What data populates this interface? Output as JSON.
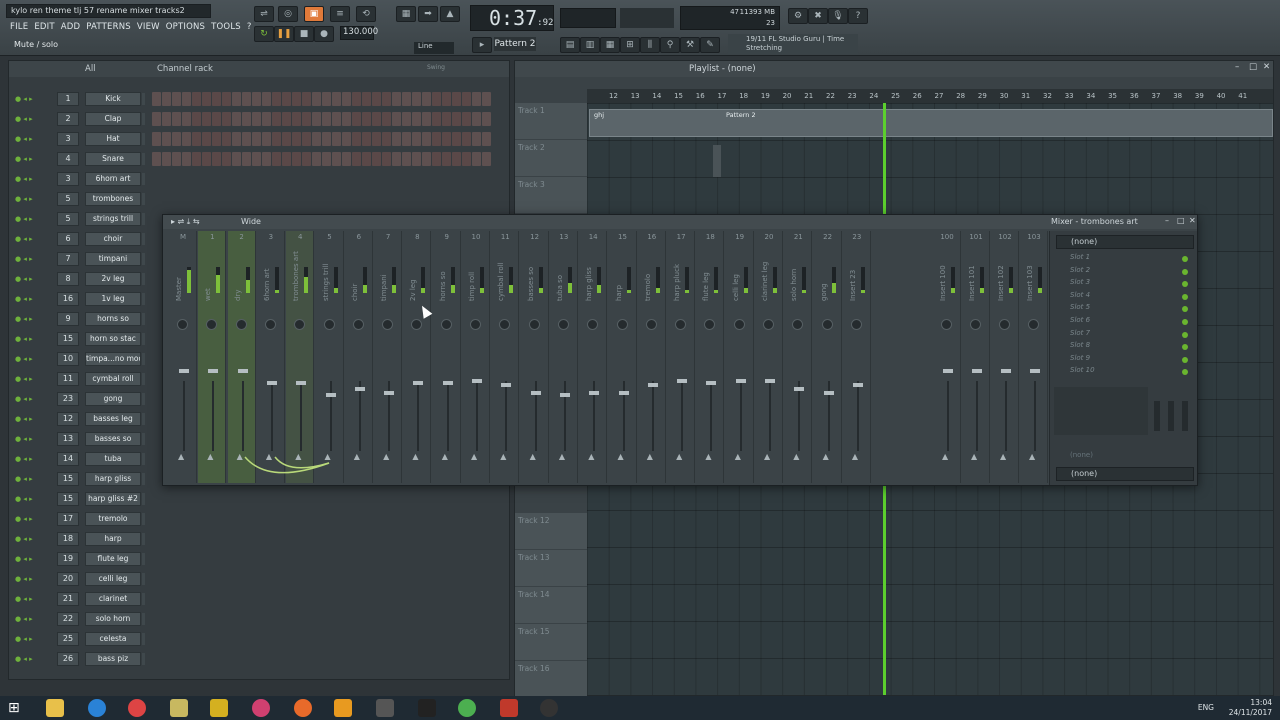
{
  "window": {
    "title": "kylo ren theme tlj 57 rename mixer tracks2"
  },
  "menu": [
    "FILE",
    "EDIT",
    "ADD",
    "PATTERNS",
    "VIEW",
    "OPTIONS",
    "TOOLS",
    "?"
  ],
  "hint": "Mute / solo",
  "transport": {
    "time": "0:37",
    "time_small": ":92",
    "tempo": "130.000",
    "pattern": "Pattern 2",
    "snap": "Line"
  },
  "cpu": {
    "a": "47",
    "b": "11393 MB",
    "c": "23"
  },
  "news": {
    "date": "19/11",
    "text": "FL Studio Guru | Time Stretching"
  },
  "rack": {
    "filter": "All",
    "title": "Channel rack",
    "swing_label": "Swing",
    "channels": [
      {
        "num": "1",
        "name": "Kick"
      },
      {
        "num": "2",
        "name": "Clap"
      },
      {
        "num": "3",
        "name": "Hat"
      },
      {
        "num": "4",
        "name": "Snare"
      },
      {
        "num": "3",
        "name": "6horn art"
      },
      {
        "num": "5",
        "name": "trombones"
      },
      {
        "num": "5",
        "name": "strings trill"
      },
      {
        "num": "6",
        "name": "choir"
      },
      {
        "num": "7",
        "name": "timpani"
      },
      {
        "num": "8",
        "name": "2v leg"
      },
      {
        "num": "16",
        "name": "1v leg"
      },
      {
        "num": "9",
        "name": "horns so"
      },
      {
        "num": "15",
        "name": "horn so stac"
      },
      {
        "num": "10",
        "name": "timpa...no mod"
      },
      {
        "num": "11",
        "name": "cymbal roll"
      },
      {
        "num": "23",
        "name": "gong"
      },
      {
        "num": "12",
        "name": "basses leg"
      },
      {
        "num": "13",
        "name": "basses so"
      },
      {
        "num": "14",
        "name": "tuba"
      },
      {
        "num": "15",
        "name": "harp gliss"
      },
      {
        "num": "15",
        "name": "harp gliss #2"
      },
      {
        "num": "17",
        "name": "tremolo"
      },
      {
        "num": "18",
        "name": "harp"
      },
      {
        "num": "19",
        "name": "flute leg"
      },
      {
        "num": "20",
        "name": "celli leg"
      },
      {
        "num": "21",
        "name": "clarinet"
      },
      {
        "num": "22",
        "name": "solo horn"
      },
      {
        "num": "25",
        "name": "celesta"
      },
      {
        "num": "26",
        "name": "bass piz"
      }
    ]
  },
  "playlist": {
    "title": "Playlist - (none)",
    "ruler": [
      "12",
      "13",
      "14",
      "15",
      "16",
      "17",
      "18",
      "19",
      "20",
      "21",
      "22",
      "23",
      "24",
      "25",
      "26",
      "27",
      "28",
      "29",
      "30",
      "31",
      "32",
      "33",
      "34",
      "35",
      "36",
      "37",
      "38",
      "39",
      "40",
      "41"
    ],
    "clip1": "ghj",
    "clip2": "Pattern 2",
    "tracks": [
      "Track 1",
      "Track 2",
      "Track 3",
      "Track 12",
      "Track 13",
      "Track 14",
      "Track 15",
      "Track 16"
    ]
  },
  "mixer": {
    "title": "Mixer - trombones art",
    "view": "Wide",
    "strips": [
      {
        "n": "M",
        "label": "Master"
      },
      {
        "n": "1",
        "label": "wet"
      },
      {
        "n": "2",
        "label": "dry"
      },
      {
        "n": "3",
        "label": "6horn art"
      },
      {
        "n": "4",
        "label": "trombones art"
      },
      {
        "n": "5",
        "label": "strings trill"
      },
      {
        "n": "6",
        "label": "choir"
      },
      {
        "n": "7",
        "label": "timpani"
      },
      {
        "n": "8",
        "label": "2v leg"
      },
      {
        "n": "9",
        "label": "horns so"
      },
      {
        "n": "10",
        "label": "timp roll"
      },
      {
        "n": "11",
        "label": "cymbal roll"
      },
      {
        "n": "12",
        "label": "basses so"
      },
      {
        "n": "13",
        "label": "tuba so"
      },
      {
        "n": "14",
        "label": "harp gliss"
      },
      {
        "n": "15",
        "label": "harp"
      },
      {
        "n": "16",
        "label": "tremolo"
      },
      {
        "n": "17",
        "label": "harp pluck"
      },
      {
        "n": "18",
        "label": "flute leg"
      },
      {
        "n": "19",
        "label": "celli leg"
      },
      {
        "n": "20",
        "label": "clarinet leg"
      },
      {
        "n": "21",
        "label": "solo horn"
      },
      {
        "n": "22",
        "label": "gong"
      },
      {
        "n": "23",
        "label": "Insert 23"
      },
      {
        "n": "100",
        "label": "Insert 100"
      },
      {
        "n": "101",
        "label": "Insert 101"
      },
      {
        "n": "102",
        "label": "Insert 102"
      },
      {
        "n": "103",
        "label": "Insert 103"
      }
    ],
    "side_top": "(none)",
    "slots": [
      "Slot 1",
      "Slot 2",
      "Slot 3",
      "Slot 4",
      "Slot 5",
      "Slot 6",
      "Slot 7",
      "Slot 8",
      "Slot 9",
      "Slot 10"
    ],
    "side_mid": "(none)",
    "side_bottom": "(none)"
  },
  "tray": {
    "lang": "ENG",
    "time": "13:04",
    "date": "24/11/2017"
  },
  "colors": {
    "accent": "#7ec03a",
    "bg": "#2e3438",
    "playhead": "#5ccf2e"
  }
}
